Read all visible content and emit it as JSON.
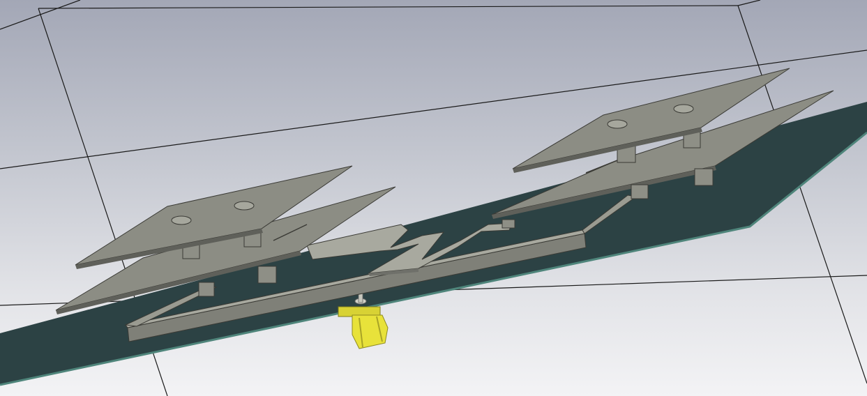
{
  "viewport": {
    "background_top": "#a3a7b6",
    "background_bottom": "#f3f3f5"
  },
  "model": {
    "substrate_color": "#2c4244",
    "substrate_edge_color": "#4a7a72",
    "metal_color": "#8a8b82",
    "metal_dark_color": "#6a6b63",
    "connector_color": "#e8e23a",
    "patch_pairs": 2,
    "standoffs_per_patch": 2,
    "connector_count": 1
  }
}
